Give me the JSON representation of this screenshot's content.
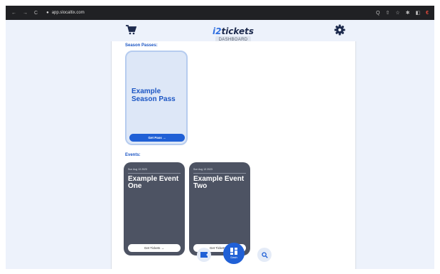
{
  "browser": {
    "back": "←",
    "forward": "→",
    "reload": "C",
    "lock": "🔒",
    "url": "app.slocaltix.com",
    "actions": [
      "Q",
      "⇧",
      "☆",
      "✱",
      "◧"
    ]
  },
  "header": {
    "brand_prefix": "i2",
    "brand_suffix": "tickets",
    "tab": "DASHBOARD"
  },
  "season_passes": {
    "heading": "Season Passes:",
    "items": [
      {
        "title": "Example Season Pass",
        "button": "Get Pass →"
      }
    ]
  },
  "events": {
    "heading": "Events:",
    "items": [
      {
        "date": "Sun Aug 13 2023",
        "title": "Example Event One",
        "button": "Get Tickets →"
      },
      {
        "date": "Sun Aug 13 2023",
        "title": "Example Event Two",
        "button": "Get Tickets →"
      }
    ]
  },
  "bottom_nav": {
    "center_label": "Dash",
    "icons": [
      "ticket-icon",
      "dashboard-icon",
      "search-icon"
    ]
  },
  "colors": {
    "accent": "#2060d6",
    "card_dark": "#4d5363",
    "card_light": "#dde7f7"
  }
}
